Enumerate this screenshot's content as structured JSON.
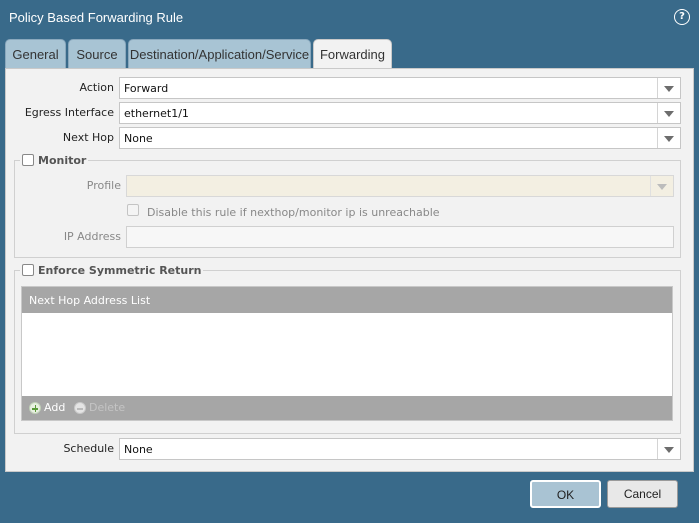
{
  "dialog": {
    "title": "Policy Based Forwarding Rule",
    "help_icon": "question-circle-icon"
  },
  "tabs": [
    {
      "label": "General",
      "active": false
    },
    {
      "label": "Source",
      "active": false
    },
    {
      "label": "Destination/Application/Service",
      "active": false
    },
    {
      "label": "Forwarding",
      "active": true
    }
  ],
  "form": {
    "action_label": "Action",
    "action_value": "Forward",
    "egress_label": "Egress Interface",
    "egress_value": "ethernet1/1",
    "nexthop_label": "Next Hop",
    "nexthop_value": "None",
    "schedule_label": "Schedule",
    "schedule_value": "None"
  },
  "monitor": {
    "label": "Monitor",
    "checked": false,
    "profile_label": "Profile",
    "profile_value": "",
    "disable_rule_label": "Disable this rule if nexthop/monitor ip is unreachable",
    "ip_label": "IP Address",
    "ip_value": ""
  },
  "symmetric": {
    "label": "Enforce Symmetric Return",
    "checked": false,
    "grid_header": "Next Hop Address List",
    "add_label": "Add",
    "delete_label": "Delete"
  },
  "buttons": {
    "ok": "OK",
    "cancel": "Cancel"
  },
  "colors": {
    "frame": "#396a8a",
    "panel": "#f2f2f2",
    "tab_inactive": "#a8c4d4",
    "grid_header": "#a6a6a6",
    "disabled_field": "#f3efe2"
  }
}
